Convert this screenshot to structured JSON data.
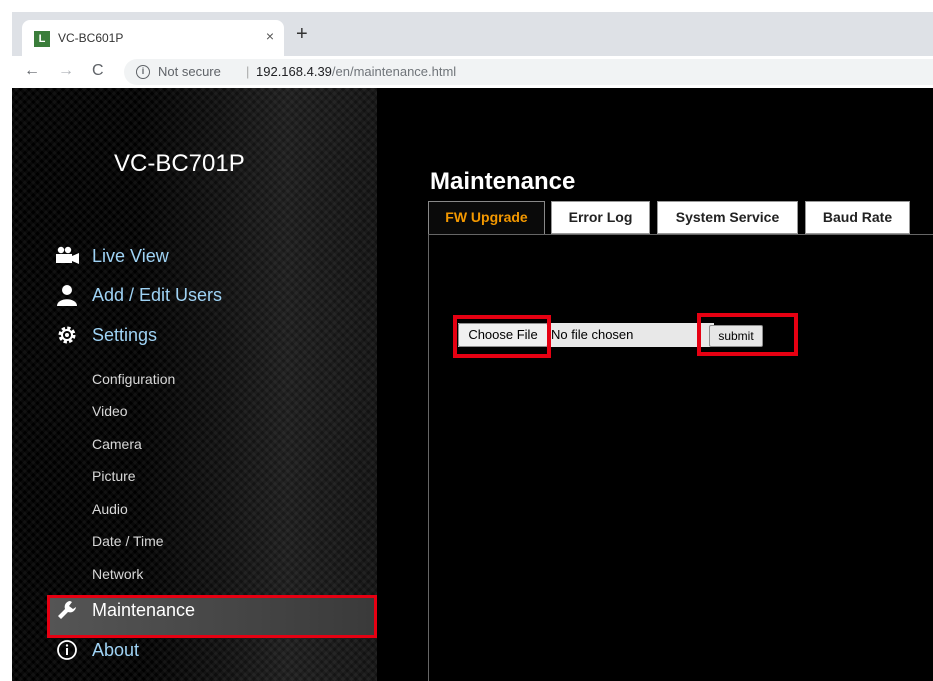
{
  "browser": {
    "tab_title": "VC-BC601P",
    "tab_close": "×",
    "new_tab": "+",
    "favicon_letter": "L",
    "nav": {
      "back": "←",
      "forward": "→",
      "reload": "C"
    },
    "security_icon": "i",
    "security_label": "Not secure",
    "separator": "|",
    "url_host": "192.168.4.39",
    "url_path": "/en/maintenance.html"
  },
  "sidebar": {
    "model_name": "VC-BC701P",
    "menu": [
      {
        "label": "Live View",
        "icon": "camera-icon"
      },
      {
        "label": "Add / Edit Users",
        "icon": "user-icon"
      },
      {
        "label": "Settings",
        "icon": "gear-icon"
      }
    ],
    "settings_items": [
      "Configuration",
      "Video",
      "Camera",
      "Picture",
      "Audio",
      "Date / Time",
      "Network"
    ],
    "maintenance": {
      "label": "Maintenance",
      "icon": "wrench-icon",
      "highlighted": true
    },
    "about": {
      "label": "About",
      "icon": "info-icon"
    }
  },
  "content": {
    "title": "Maintenance",
    "tabs": [
      "FW Upgrade",
      "Error Log",
      "System Service",
      "Baud Rate"
    ],
    "active_tab": "FW Upgrade",
    "choose_file_label": "Choose File",
    "file_status": "No file chosen",
    "submit_label": "submit"
  },
  "colors": {
    "accent_active_tab": "#f39800",
    "highlight_red": "#e60012",
    "menu_text": "#9fd3f5"
  }
}
